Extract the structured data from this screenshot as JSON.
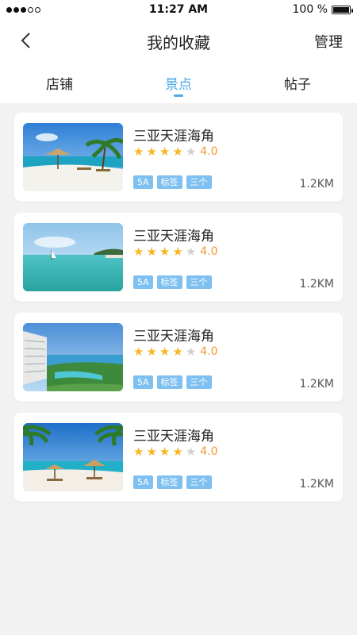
{
  "status_bar": {
    "time": "11:27 AM",
    "battery": "100 %",
    "battery_level": 1.0
  },
  "nav": {
    "back_icon": "chevron-left-icon",
    "title": "我的收藏",
    "manage": "管理"
  },
  "tabs": [
    {
      "label": "店铺",
      "active": false
    },
    {
      "label": "景点",
      "active": true
    },
    {
      "label": "帖子",
      "active": false
    }
  ],
  "colors": {
    "accent": "#4aa9e9",
    "star": "#f5b823",
    "rating": "#f29a2e",
    "tag_bg": "#7ec0ef"
  },
  "items": [
    {
      "title": "三亚天涯海角",
      "rating": "4.0",
      "stars": 4,
      "tags": [
        "5A",
        "标签",
        "三个"
      ],
      "distance": "1.2KM",
      "image": "beach-umbrella-palms"
    },
    {
      "title": "三亚天涯海角",
      "rating": "4.0",
      "stars": 4,
      "tags": [
        "5A",
        "标签",
        "三个"
      ],
      "distance": "1.2KM",
      "image": "turquoise-sea-boat"
    },
    {
      "title": "三亚天涯海角",
      "rating": "4.0",
      "stars": 4,
      "tags": [
        "5A",
        "标签",
        "三个"
      ],
      "distance": "1.2KM",
      "image": "resort-hotel-coast"
    },
    {
      "title": "三亚天涯海角",
      "rating": "4.0",
      "stars": 4,
      "tags": [
        "5A",
        "标签",
        "三个"
      ],
      "distance": "1.2KM",
      "image": "beach-umbrellas-palms"
    }
  ]
}
